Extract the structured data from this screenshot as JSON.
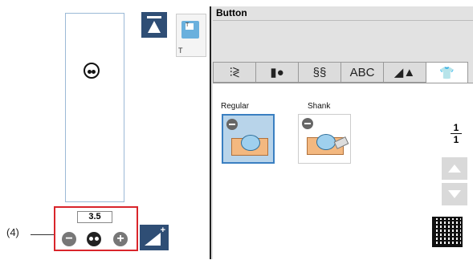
{
  "callout": {
    "label": "(4)"
  },
  "header": {
    "title": "Button"
  },
  "left_panel": {
    "width_value": "3.5",
    "foot_label": "T",
    "foot_icon_letter": "T",
    "minus_label": "−",
    "plus_label": "+",
    "ref_label": "+"
  },
  "tabs": [
    {
      "label": "⫶≷",
      "icon": "utility-stitch-icon"
    },
    {
      "label": "▮●",
      "icon": "buttonhole-icon"
    },
    {
      "label": "§§",
      "icon": "decorative-stitch-icon"
    },
    {
      "label": "ABC",
      "icon": "character-icon"
    },
    {
      "label": "◢▲",
      "icon": "satin-stitch-icon"
    },
    {
      "label": "👕",
      "icon": "shirt-icon"
    }
  ],
  "stitches": [
    {
      "label": "Regular",
      "selected": true
    },
    {
      "label": "Shank",
      "selected": false
    }
  ],
  "pagination": {
    "current": "1",
    "total": "1"
  },
  "colors": {
    "selection": "#3a7fc1",
    "button_dark": "#2f4e75",
    "callout_red": "#d9252b"
  }
}
